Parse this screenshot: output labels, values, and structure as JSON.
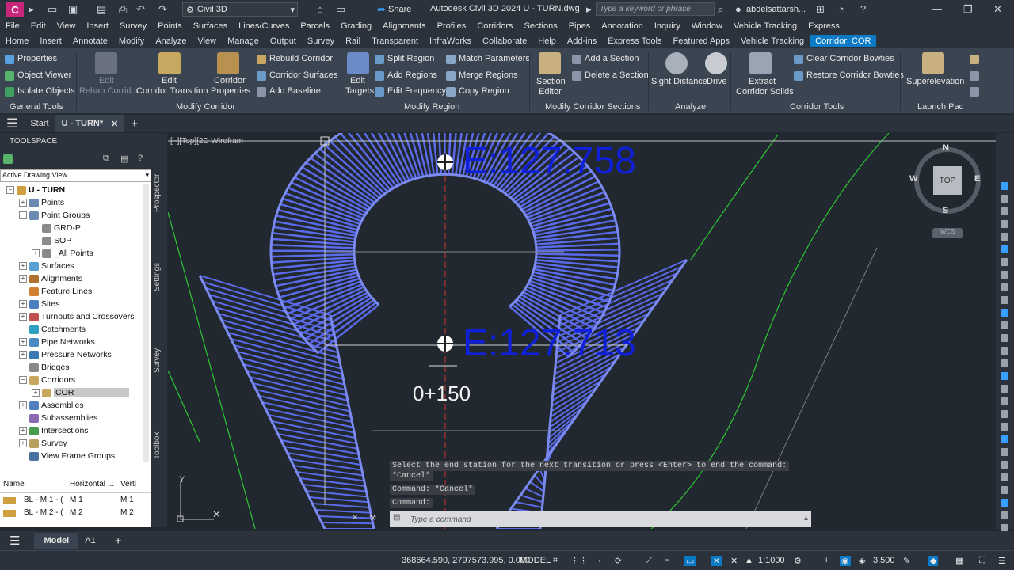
{
  "titlebar": {
    "logo": "C",
    "workspace": "Civil 3D",
    "share": "Share",
    "title": "Autodesk Civil 3D 2024    U - TURN.dwg",
    "search_placeholder": "Type a keyword or phrase",
    "user": "abdelsattarsh..."
  },
  "menu": [
    "File",
    "Edit",
    "View",
    "Insert",
    "Survey",
    "Points",
    "Surfaces",
    "Lines/Curves",
    "Parcels",
    "Grading",
    "Alignments",
    "Profiles",
    "Corridors",
    "Sections",
    "Pipes",
    "Annotation",
    "Inquiry",
    "Window",
    "Vehicle Tracking",
    "Express"
  ],
  "ribbon_tabs": [
    "Home",
    "Insert",
    "Annotate",
    "Modify",
    "Analyze",
    "View",
    "Manage",
    "Output",
    "Survey",
    "Rail",
    "Transparent",
    "InfraWorks",
    "Collaborate",
    "Help",
    "Add-ins",
    "Express Tools",
    "Featured Apps",
    "Vehicle Tracking",
    "Corridor: COR"
  ],
  "ribbon": {
    "general": {
      "properties": "Properties",
      "object_viewer": "Object Viewer",
      "isolate": "Isolate Objects",
      "title": "General Tools"
    },
    "modify": {
      "edit_rehab": "Edit",
      "edit_rehab2": "Rehab Corridor",
      "edit_trans": "Edit",
      "edit_trans2": "Corridor Transition",
      "corr_props": "Corridor",
      "corr_props2": "Properties",
      "rebuild": "Rebuild Corridor",
      "surfaces": "Corridor Surfaces",
      "add_baseline": "Add Baseline",
      "title": "Modify Corridor"
    },
    "region": {
      "edit_targets": "Edit",
      "edit_targets2": "Targets",
      "split": "Split Region",
      "add": "Add Regions",
      "freq": "Edit Frequency",
      "match": "Match Parameters",
      "merge": "Merge Regions",
      "copy": "Copy Region",
      "title": "Modify Region"
    },
    "sections": {
      "editor": "Section",
      "editor2": "Editor",
      "add": "Add a Section",
      "delete": "Delete a Section",
      "title": "Modify Corridor Sections"
    },
    "analyze": {
      "sight": "Sight Distance",
      "drive": "Drive",
      "title": "Analyze"
    },
    "tools": {
      "extract": "Extract",
      "extract2": "Corridor Solids",
      "clear": "Clear Corridor Bowties",
      "restore": "Restore Corridor Bowties",
      "title": "Corridor Tools"
    },
    "launch": {
      "super": "Superelevation",
      "title": "Launch Pad"
    }
  },
  "doc_tabs": {
    "start": "Start",
    "active": "U - TURN*"
  },
  "toolspace": {
    "header": "TOOLSPACE",
    "view": "Active Drawing View",
    "tree": [
      {
        "label": "U - TURN",
        "level": 0,
        "bold": true
      },
      {
        "label": "Points",
        "level": 1
      },
      {
        "label": "Point Groups",
        "level": 1
      },
      {
        "label": "GRD-P",
        "level": 2
      },
      {
        "label": "SOP",
        "level": 2
      },
      {
        "label": "_All Points",
        "level": 2
      },
      {
        "label": "Surfaces",
        "level": 1
      },
      {
        "label": "Alignments",
        "level": 1
      },
      {
        "label": "Feature Lines",
        "level": 1
      },
      {
        "label": "Sites",
        "level": 1
      },
      {
        "label": "Turnouts and Crossovers",
        "level": 1
      },
      {
        "label": "Catchments",
        "level": 1
      },
      {
        "label": "Pipe Networks",
        "level": 1
      },
      {
        "label": "Pressure Networks",
        "level": 1
      },
      {
        "label": "Bridges",
        "level": 1
      },
      {
        "label": "Corridors",
        "level": 1
      },
      {
        "label": "COR",
        "level": 2,
        "selected": true
      },
      {
        "label": "Assemblies",
        "level": 1
      },
      {
        "label": "Subassemblies",
        "level": 1
      },
      {
        "label": "Intersections",
        "level": 1
      },
      {
        "label": "Survey",
        "level": 1
      },
      {
        "label": "View Frame Groups",
        "level": 1
      }
    ],
    "vtabs": [
      "Prospector",
      "Settings",
      "Survey",
      "Toolbox"
    ],
    "grid": {
      "headers": [
        "Name",
        "Horizontal ...",
        "Verti"
      ],
      "rows": [
        [
          "BL - M 1 - (",
          "M 1",
          "M 1"
        ],
        [
          "BL - M 2 - (",
          "M 2",
          "M 2"
        ]
      ]
    }
  },
  "viewport": {
    "label": "[−][Top][2D Wirefram",
    "station": "0+150",
    "label_top": "E:127.758",
    "label_mid": "E:127.713",
    "compass": {
      "n": "N",
      "s": "S",
      "e": "E",
      "w": "W",
      "top": "TOP",
      "wcs": "WCS"
    }
  },
  "command": {
    "lines": [
      "Select the end station for the next transition or press <Enter> to end the command:",
      "*Cancel*",
      "Command: *Cancel*",
      "Command:"
    ],
    "placeholder": "Type a command"
  },
  "bottom": {
    "model": "Model",
    "a1": "A1"
  },
  "status": {
    "coords": "368664.590, 2797573.995, 0.000",
    "model": "MODEL",
    "scale": "1:1000",
    "value": "3.500"
  }
}
